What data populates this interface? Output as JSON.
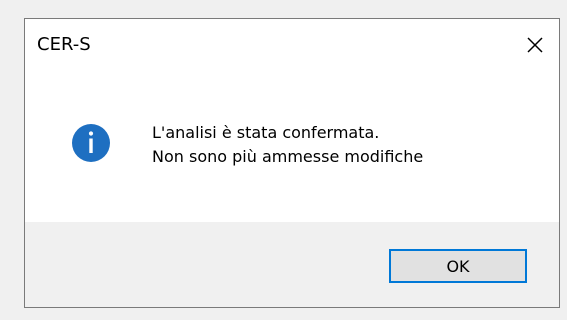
{
  "window": {
    "title": "CER-S"
  },
  "message": {
    "line1": "L'analisi è stata confermata.",
    "line2": "Non sono più ammesse modifiche"
  },
  "buttons": {
    "ok_label": "OK"
  },
  "icons": {
    "info": "info-icon",
    "close": "close-icon"
  },
  "colors": {
    "info_icon_fill": "#1e6fc1",
    "button_focus_border": "#0078d7",
    "footer_background": "#f0f0f0",
    "content_background": "#ffffff"
  }
}
